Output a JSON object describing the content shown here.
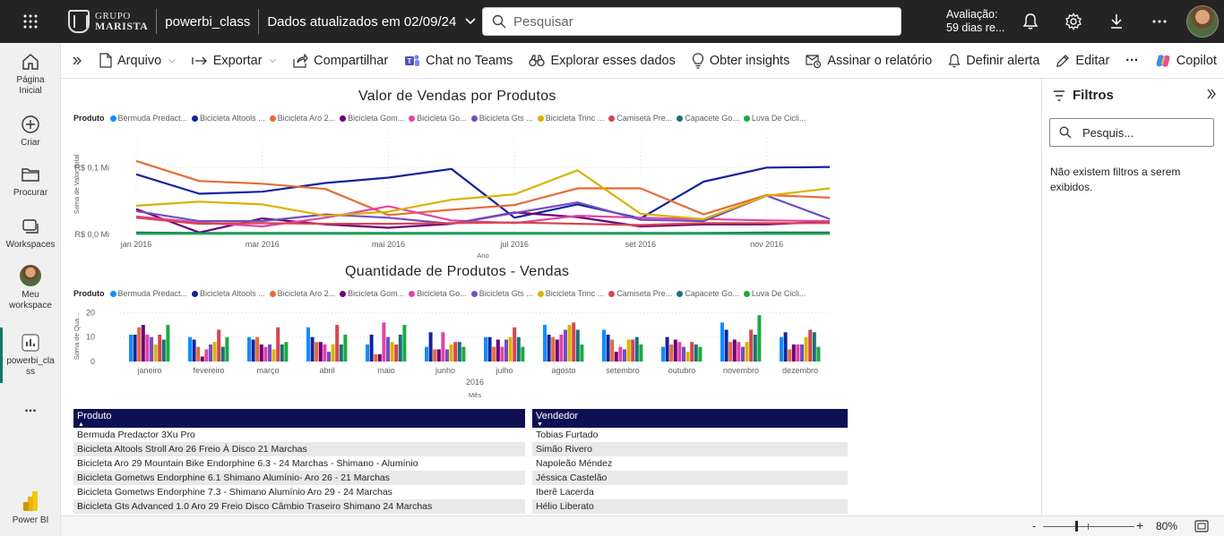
{
  "topbar": {
    "org_name_line1": "GRUPO",
    "org_name_line2": "MARISTA",
    "app_name": "powerbi_class",
    "data_updated": "Dados atualizados em 02/09/24",
    "search_placeholder": "Pesquisar",
    "trial_line1": "Avaliação:",
    "trial_line2": "59 dias re..."
  },
  "leftnav": {
    "items": [
      {
        "label": "Página Inicial",
        "icon": "home-icon"
      },
      {
        "label": "Criar",
        "icon": "plus-circle-icon"
      },
      {
        "label": "Procurar",
        "icon": "folder-icon"
      },
      {
        "label": "Workspaces",
        "icon": "workspaces-icon"
      },
      {
        "label": "Meu workspace",
        "icon": "avatar"
      },
      {
        "label": "powerbi_cla ss",
        "icon": "report-icon",
        "active": true
      },
      {
        "label": "...",
        "icon": "more-icon"
      },
      {
        "label": "Power BI",
        "icon": "powerbi-logo"
      }
    ]
  },
  "toolbar": {
    "file": "Arquivo",
    "export": "Exportar",
    "share": "Compartilhar",
    "teams": "Chat no Teams",
    "explore": "Explorar esses dados",
    "insights": "Obter insights",
    "subscribe": "Assinar o relatório",
    "alert": "Definir alerta",
    "edit": "Editar",
    "more": "···",
    "copilot": "Copilot"
  },
  "legend_title": "Produto",
  "legend_items": [
    {
      "label": "Bermuda Predact...",
      "color": "#118DFF"
    },
    {
      "label": "Bicicleta Altools ...",
      "color": "#12239E"
    },
    {
      "label": "Bicicleta Aro 2...",
      "color": "#E66C37"
    },
    {
      "label": "Bicicleta Gom...",
      "color": "#6B007B"
    },
    {
      "label": "Bicicleta Go...",
      "color": "#E044A7"
    },
    {
      "label": "Bicicleta Gts ...",
      "color": "#744EC2"
    },
    {
      "label": "Bicicleta Trinc ...",
      "color": "#D9B300"
    },
    {
      "label": "Camiseta Pre...",
      "color": "#D64550"
    },
    {
      "label": "Capacete Go...",
      "color": "#197278"
    },
    {
      "label": "Luva De Cicli...",
      "color": "#1AAB40"
    }
  ],
  "chart_data": [
    {
      "type": "line",
      "title": "Valor de Vendas por Produtos",
      "xlabel": "Ano",
      "ylabel": "Soma de Valor Total",
      "x_tick_labels": [
        "jan 2016",
        "mar 2016",
        "mai 2016",
        "jul 2016",
        "set 2016",
        "nov 2016"
      ],
      "y_tick_labels": [
        "R$ 0,0 Mi",
        "R$ 0,1 Mi"
      ],
      "ylim": [
        0,
        0.15
      ],
      "months": [
        "jan",
        "fev",
        "mar",
        "abr",
        "mai",
        "jun",
        "jul",
        "ago",
        "set",
        "out",
        "nov",
        "dez"
      ],
      "series": [
        {
          "name": "Bermuda Predact...",
          "color": "#118DFF",
          "values": [
            0.002,
            0.002,
            0.002,
            0.002,
            0.002,
            0.002,
            0.002,
            0.002,
            0.002,
            0.002,
            0.002,
            0.002
          ]
        },
        {
          "name": "Bicicleta Altools ...",
          "color": "#12239E",
          "values": [
            0.09,
            0.061,
            0.064,
            0.077,
            0.085,
            0.098,
            0.025,
            0.045,
            0.024,
            0.079,
            0.1,
            0.101
          ]
        },
        {
          "name": "Bicicleta Aro 2...",
          "color": "#E66C37",
          "values": [
            0.11,
            0.08,
            0.076,
            0.068,
            0.029,
            0.037,
            0.044,
            0.069,
            0.069,
            0.03,
            0.059,
            0.055
          ]
        },
        {
          "name": "Bicicleta Gom...",
          "color": "#6B007B",
          "values": [
            0.038,
            0.003,
            0.024,
            0.015,
            0.01,
            0.016,
            0.033,
            0.026,
            0.012,
            0.015,
            0.015,
            0.019
          ]
        },
        {
          "name": "Bicicleta Go...",
          "color": "#E044A7",
          "values": [
            0.027,
            0.018,
            0.012,
            0.025,
            0.042,
            0.021,
            0.017,
            0.028,
            0.025,
            0.023,
            0.021,
            0.02
          ]
        },
        {
          "name": "Bicicleta Gts ...",
          "color": "#744EC2",
          "values": [
            0.035,
            0.02,
            0.02,
            0.03,
            0.025,
            0.016,
            0.032,
            0.048,
            0.022,
            0.02,
            0.058,
            0.023
          ]
        },
        {
          "name": "Bicicleta Trinc ...",
          "color": "#D9B300",
          "values": [
            0.043,
            0.049,
            0.045,
            0.028,
            0.034,
            0.052,
            0.06,
            0.096,
            0.031,
            0.023,
            0.058,
            0.069
          ]
        },
        {
          "name": "Camiseta Pre...",
          "color": "#D64550",
          "values": [
            0.025,
            0.016,
            0.017,
            0.016,
            0.016,
            0.017,
            0.018,
            0.016,
            0.014,
            0.017,
            0.017,
            0.017
          ]
        },
        {
          "name": "Capacete Go...",
          "color": "#197278",
          "values": [
            0.003,
            0.002,
            0.002,
            0.002,
            0.002,
            0.002,
            0.002,
            0.002,
            0.002,
            0.002,
            0.003,
            0.003
          ]
        },
        {
          "name": "Luva De Cicli...",
          "color": "#1AAB40",
          "values": [
            0.001,
            0.001,
            0.001,
            0.001,
            0.001,
            0.001,
            0.001,
            0.001,
            0.001,
            0.001,
            0.001,
            0.001
          ]
        }
      ]
    },
    {
      "type": "bar",
      "title": "Quantidade de Produtos - Vendas",
      "xlabel": "Mês",
      "xlabel_year": "2016",
      "ylabel": "Soma de Qua...",
      "ylim": [
        0,
        22
      ],
      "y_ticks": [
        0,
        10,
        20
      ],
      "categories": [
        "janeiro",
        "fevereiro",
        "março",
        "abril",
        "maio",
        "junho",
        "julho",
        "agosto",
        "setembro",
        "outubro",
        "novembro",
        "dezembro"
      ],
      "series": [
        {
          "name": "Bermuda Predact...",
          "color": "#118DFF",
          "values": [
            11,
            10,
            10,
            14,
            7,
            6,
            10,
            15,
            13,
            6,
            16,
            10
          ]
        },
        {
          "name": "Bicicleta Altools ...",
          "color": "#12239E",
          "values": [
            11,
            9,
            9,
            10,
            11,
            12,
            10,
            11,
            11,
            10,
            13,
            12
          ]
        },
        {
          "name": "Bicicleta Aro 2...",
          "color": "#E66C37",
          "values": [
            14,
            6,
            10,
            8,
            3,
            5,
            6,
            10,
            9,
            7,
            8,
            5
          ]
        },
        {
          "name": "Bicicleta Gom...",
          "color": "#6B007B",
          "values": [
            15,
            2,
            7,
            8,
            3,
            5,
            9,
            9,
            4,
            9,
            9,
            7
          ]
        },
        {
          "name": "Bicicleta Go...",
          "color": "#E044A7",
          "values": [
            11,
            5,
            6,
            7,
            16,
            12,
            6,
            11,
            6,
            8,
            8,
            7
          ]
        },
        {
          "name": "Bicicleta Gts ...",
          "color": "#744EC2",
          "values": [
            10,
            7,
            7,
            4,
            10,
            5,
            9,
            13,
            5,
            6,
            6,
            7
          ]
        },
        {
          "name": "Bicicleta Trinc ...",
          "color": "#D9B300",
          "values": [
            7,
            8,
            5,
            7,
            8,
            7,
            10,
            15,
            9,
            4,
            8,
            10
          ]
        },
        {
          "name": "Camiseta Pre...",
          "color": "#D64550",
          "values": [
            11,
            13,
            14,
            15,
            7,
            8,
            14,
            16,
            9,
            8,
            13,
            13
          ]
        },
        {
          "name": "Capacete Go...",
          "color": "#197278",
          "values": [
            9,
            6,
            7,
            7,
            11,
            8,
            10,
            13,
            10,
            7,
            11,
            12
          ]
        },
        {
          "name": "Luva De Cicli...",
          "color": "#1AAB40",
          "values": [
            15,
            10,
            8,
            11,
            15,
            6,
            6,
            7,
            7,
            6,
            19,
            6
          ]
        }
      ]
    }
  ],
  "table_produto": {
    "header": "Produto",
    "rows": [
      "Bermuda Predactor 3Xu Pro",
      "Bicicleta Altools Stroll Aro 26 Freio À Disco 21 Marchas",
      "Bicicleta Aro 29 Mountain Bike Endorphine 6.3 - 24 Marchas - Shimano - Alumínio",
      "Bicicleta Gometws Endorphine 6.1 Shimano Alumínio- Aro 26 - 21 Marchas",
      "Bicicleta Gometws Endorphine 7.3 - Shimano Alumínio Aro 29 - 24 Marchas",
      "Bicicleta Gts Advanced 1.0 Aro 29 Freio Disco Câmbio Traseiro Shimano 24 Marchas"
    ]
  },
  "table_vendedor": {
    "header": "Vendedor",
    "rows": [
      "Tobias Furtado",
      "Simão Rivero",
      "Napoleão Méndez",
      "Jéssica Castelão",
      "Iberê Lacerda",
      "Hélio Liberato"
    ]
  },
  "filters": {
    "title": "Filtros",
    "search_placeholder": "Pesquis...",
    "empty_text": "Não existem filtros a serem exibidos."
  },
  "statusbar": {
    "zoom_minus": "-",
    "zoom_plus": "+",
    "zoom_value": "80%"
  }
}
